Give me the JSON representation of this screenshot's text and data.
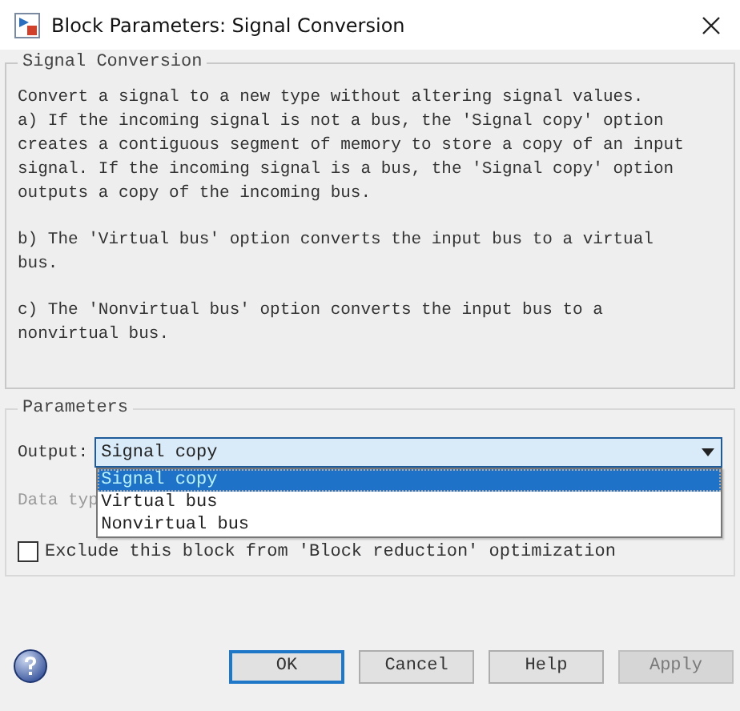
{
  "window": {
    "title": "Block Parameters: Signal Conversion"
  },
  "description": {
    "title": "Signal Conversion",
    "paragraphs": [
      "Convert a signal to a new type without altering signal values.\na) If the incoming signal is not a bus, the 'Signal copy' option creates a contiguous segment of memory to store a copy of an input signal. If the incoming signal is a bus, the 'Signal copy' option outputs a copy of the incoming bus.",
      "b) The 'Virtual bus' option converts the input bus to a virtual bus.",
      "c) The 'Nonvirtual bus' option converts the input bus to a nonvirtual bus."
    ]
  },
  "parameters": {
    "title": "Parameters",
    "output": {
      "label": "Output:",
      "value": "Signal copy",
      "expanded": true,
      "options": [
        {
          "label": "Signal copy",
          "selected": true
        },
        {
          "label": "Virtual bus",
          "selected": false
        },
        {
          "label": "Nonvirtual bus",
          "selected": false
        }
      ]
    },
    "data_type": {
      "label": "Data typ",
      "disabled": true
    },
    "exclude": {
      "label": "Exclude this block from 'Block reduction' optimization",
      "checked": false
    }
  },
  "buttons": [
    {
      "label": "OK",
      "default": true,
      "disabled": false
    },
    {
      "label": "Cancel",
      "default": false,
      "disabled": false
    },
    {
      "label": "Help",
      "default": false,
      "disabled": false
    },
    {
      "label": "Apply",
      "default": false,
      "disabled": true
    }
  ]
}
